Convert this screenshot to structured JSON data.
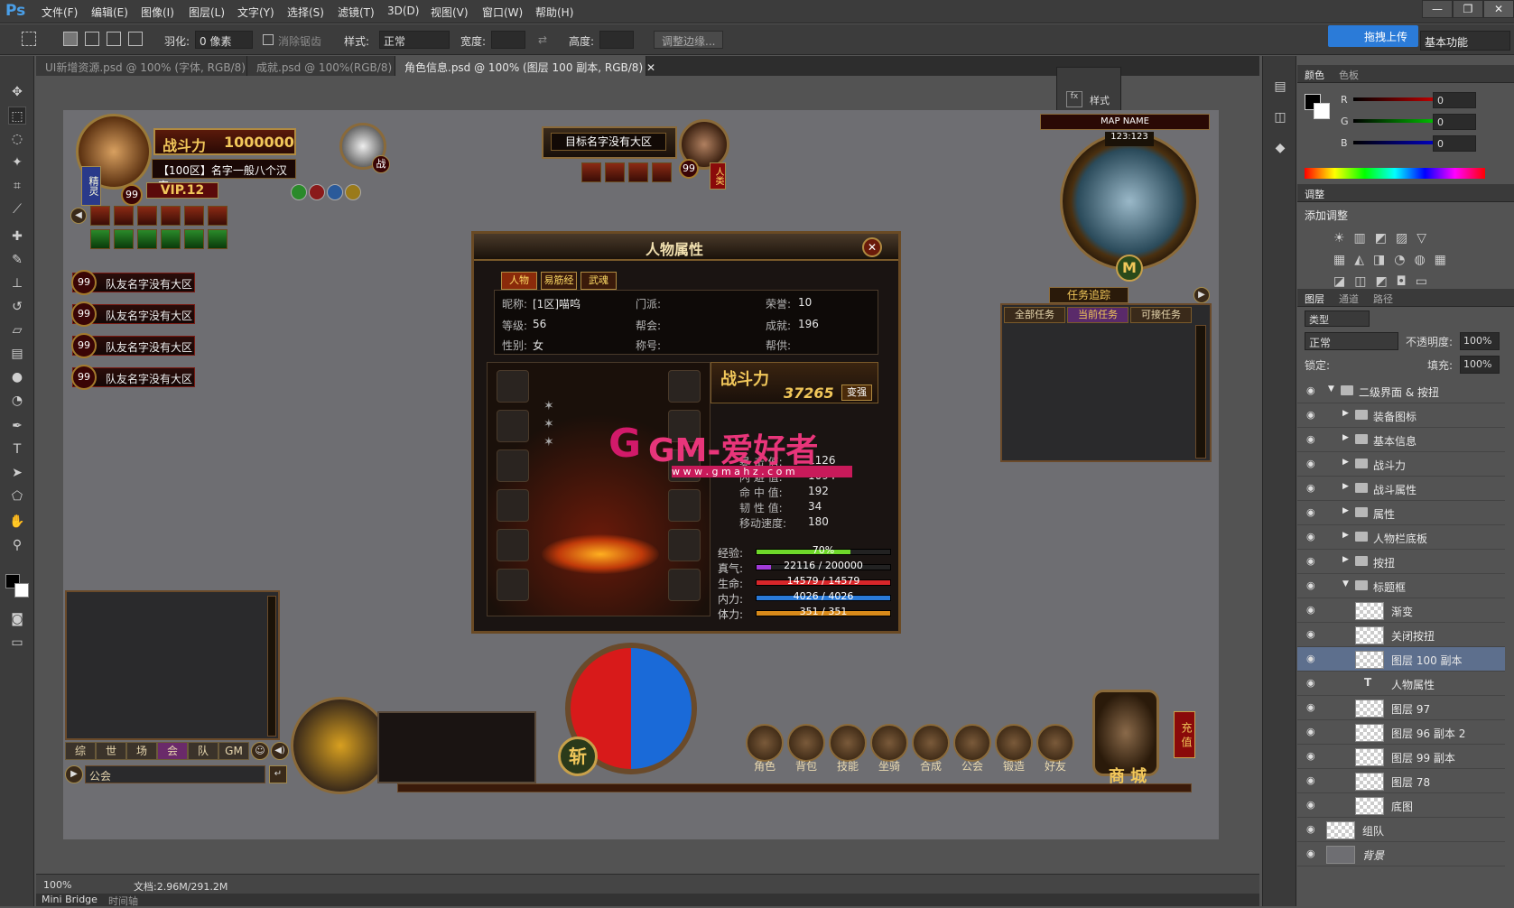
{
  "app": {
    "logo": "Ps",
    "menu": [
      "文件(F)",
      "编辑(E)",
      "图像(I)",
      "图层(L)",
      "文字(Y)",
      "选择(S)",
      "滤镜(T)",
      "3D(D)",
      "视图(V)",
      "窗口(W)",
      "帮助(H)"
    ],
    "window_buttons": [
      "—",
      "❐",
      "✕"
    ]
  },
  "options": {
    "feather_label": "羽化:",
    "feather_value": "0 像素",
    "antialias_label": "消除锯齿",
    "style_label": "样式:",
    "style_value": "正常",
    "width_label": "宽度:",
    "height_label": "高度:",
    "refine_button": "调整边缘...",
    "upload_button": "拖拽上传",
    "workspace": "基本功能"
  },
  "tabs": [
    {
      "label": "UI新增资源.psd @ 100% (字体, RGB/8)",
      "close": "✕"
    },
    {
      "label": "成就.psd @ 100%(RGB/8)",
      "close": "✕"
    },
    {
      "label": "角色信息.psd @ 100% (图层 100 副本, RGB/8)",
      "close": "✕"
    }
  ],
  "style_panel": {
    "label": "样式"
  },
  "status": {
    "zoom": "100%",
    "doc": "文档:2.96M/291.2M"
  },
  "bottom_tabs": [
    "Mini Bridge",
    "时间轴"
  ],
  "color_panel": {
    "tabs": [
      "颜色",
      "色板"
    ],
    "channels": [
      {
        "name": "R",
        "value": "0"
      },
      {
        "name": "G",
        "value": "0"
      },
      {
        "name": "B",
        "value": "0"
      }
    ]
  },
  "adjust_panel": {
    "tab": "调整",
    "label": "添加调整"
  },
  "layers_panel": {
    "tabs": [
      "图层",
      "通道",
      "路径"
    ],
    "filter": "类型",
    "blend": "正常",
    "opacity_label": "不透明度:",
    "opacity": "100%",
    "lock_label": "锁定:",
    "fill_label": "填充:",
    "fill": "100%",
    "layers": [
      {
        "name": "二级界面 & 按扭",
        "kind": "group-open",
        "indent": 0
      },
      {
        "name": "装备图标",
        "kind": "group",
        "indent": 1
      },
      {
        "name": "基本信息",
        "kind": "group",
        "indent": 1
      },
      {
        "name": "战斗力",
        "kind": "group",
        "indent": 1
      },
      {
        "name": "战斗属性",
        "kind": "group",
        "indent": 1
      },
      {
        "name": "属性",
        "kind": "group",
        "indent": 1
      },
      {
        "name": "人物栏底板",
        "kind": "group",
        "indent": 1
      },
      {
        "name": "按扭",
        "kind": "group",
        "indent": 1
      },
      {
        "name": "标题框",
        "kind": "group-open",
        "indent": 1
      },
      {
        "name": "渐变",
        "kind": "layer",
        "indent": 2
      },
      {
        "name": "关闭按扭",
        "kind": "layer",
        "indent": 2
      },
      {
        "name": "图层 100 副本",
        "kind": "layer",
        "indent": 2,
        "selected": true
      },
      {
        "name": "人物属性",
        "kind": "text",
        "indent": 2
      },
      {
        "name": "图层 97",
        "kind": "layer",
        "indent": 2
      },
      {
        "name": "图层 96 副本 2",
        "kind": "layer",
        "indent": 2
      },
      {
        "name": "图层 99 副本",
        "kind": "layer",
        "indent": 2
      },
      {
        "name": "图层 78",
        "kind": "layer",
        "indent": 2
      },
      {
        "name": "底图",
        "kind": "layer",
        "indent": 2
      },
      {
        "name": "组队",
        "kind": "layer",
        "indent": 0
      },
      {
        "name": "背景",
        "kind": "bg",
        "indent": 0
      }
    ]
  },
  "game": {
    "player": {
      "power_label": "战斗力",
      "power": "1000000",
      "name": "【100区】名字一般八个汉字",
      "level": "99",
      "vip": "VIP.12",
      "spirit": "精灵"
    },
    "pet": {
      "tag": "战"
    },
    "target": {
      "name": "目标名字没有大区",
      "level": "99",
      "tag": "人类"
    },
    "minimap": {
      "map_name": "MAP NAME",
      "coords": "123:123",
      "m": "M"
    },
    "party": [
      {
        "level": "99",
        "name": "队友名字没有大区"
      },
      {
        "level": "99",
        "name": "队友名字没有大区"
      },
      {
        "level": "99",
        "name": "队友名字没有大区"
      },
      {
        "level": "99",
        "name": "队友名字没有大区"
      }
    ],
    "quest": {
      "title": "任务追踪",
      "tabs": [
        "全部任务",
        "当前任务",
        "可接任务"
      ]
    },
    "panel": {
      "title": "人物属性",
      "tabs": [
        "人物",
        "易筋经",
        "武魂"
      ],
      "info": [
        {
          "k": "昵称:",
          "v": "[1区]喵呜"
        },
        {
          "k": "门派:",
          "v": ""
        },
        {
          "k": "荣誉:",
          "v": "10"
        },
        {
          "k": "等级:",
          "v": "56"
        },
        {
          "k": "帮会:",
          "v": ""
        },
        {
          "k": "成就:",
          "v": "196"
        },
        {
          "k": "性别:",
          "v": "女"
        },
        {
          "k": "称号:",
          "v": ""
        },
        {
          "k": "帮供:",
          "v": ""
        }
      ],
      "power_label": "战斗力",
      "power": "37265",
      "strengthen": "变强",
      "stats": [
        {
          "k": "暴 击 值:",
          "v": "1126"
        },
        {
          "k": "闪 避 值:",
          "v": "1094"
        },
        {
          "k": "命 中 值:",
          "v": "192"
        },
        {
          "k": "韧 性 值:",
          "v": "34"
        },
        {
          "k": "移动速度:",
          "v": "180"
        }
      ],
      "bars": [
        {
          "k": "经验:",
          "text": "70%",
          "pct": 0.7,
          "color": "#6fd82a"
        },
        {
          "k": "真气:",
          "text": "22116 / 200000",
          "pct": 0.11,
          "color": "#a23bd8"
        },
        {
          "k": "生命:",
          "text": "14579 / 14579",
          "pct": 1.0,
          "color": "#d8262a"
        },
        {
          "k": "内力:",
          "text": "4026 / 4026",
          "pct": 1.0,
          "color": "#2a7ad8"
        },
        {
          "k": "体力:",
          "text": "351 / 351",
          "pct": 1.0,
          "color": "#d88a1a"
        }
      ]
    },
    "watermark": {
      "title": "GM-爱好者",
      "url": "w w w . g m a h z . c o m"
    },
    "chat": {
      "tabs": [
        "综",
        "世",
        "场",
        "会",
        "队",
        "GM"
      ],
      "channel": "公会"
    },
    "hud": {
      "slash": "斩",
      "menu": [
        "角色",
        "背包",
        "技能",
        "坐骑",
        "合成",
        "公会",
        "锻造",
        "好友"
      ],
      "shop": "商 城",
      "recharge": "充 值"
    }
  }
}
